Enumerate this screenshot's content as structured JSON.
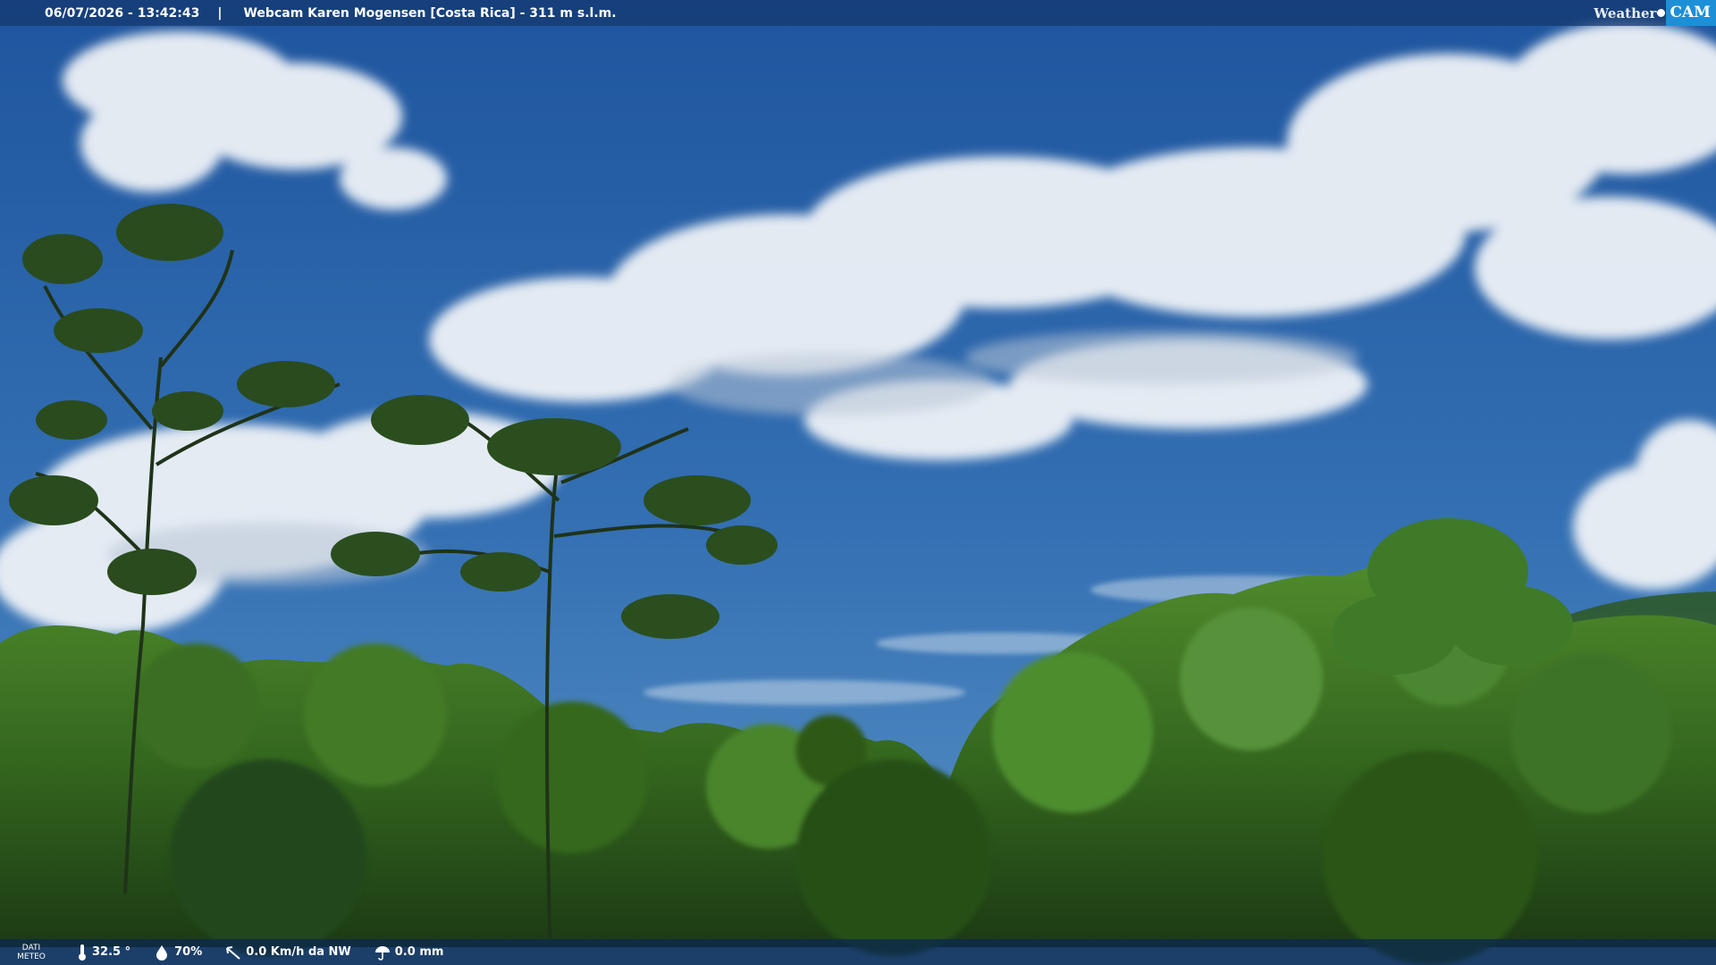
{
  "overlay": {
    "timestamp": "06/07/2026 - 13:42:43",
    "separator": "|",
    "title": "Webcam Karen Mogensen [Costa Rica] - 311 m s.l.m.",
    "logo_weather": "Weather",
    "logo_cam": "CAM"
  },
  "weather": {
    "label_line1": "DATI",
    "label_line2": "METEO",
    "temperature": "32.5 °",
    "humidity": "70%",
    "wind": "0.0 Km/h da NW",
    "rain": "0.0 mm"
  },
  "colors": {
    "sky_top": "#1f559e",
    "sky_bottom": "#4a86c2",
    "forest_dark": "#1c3a14",
    "forest_light": "#4f8a2c",
    "bar": "#14376e",
    "logo_accent": "#1d8fd6"
  }
}
